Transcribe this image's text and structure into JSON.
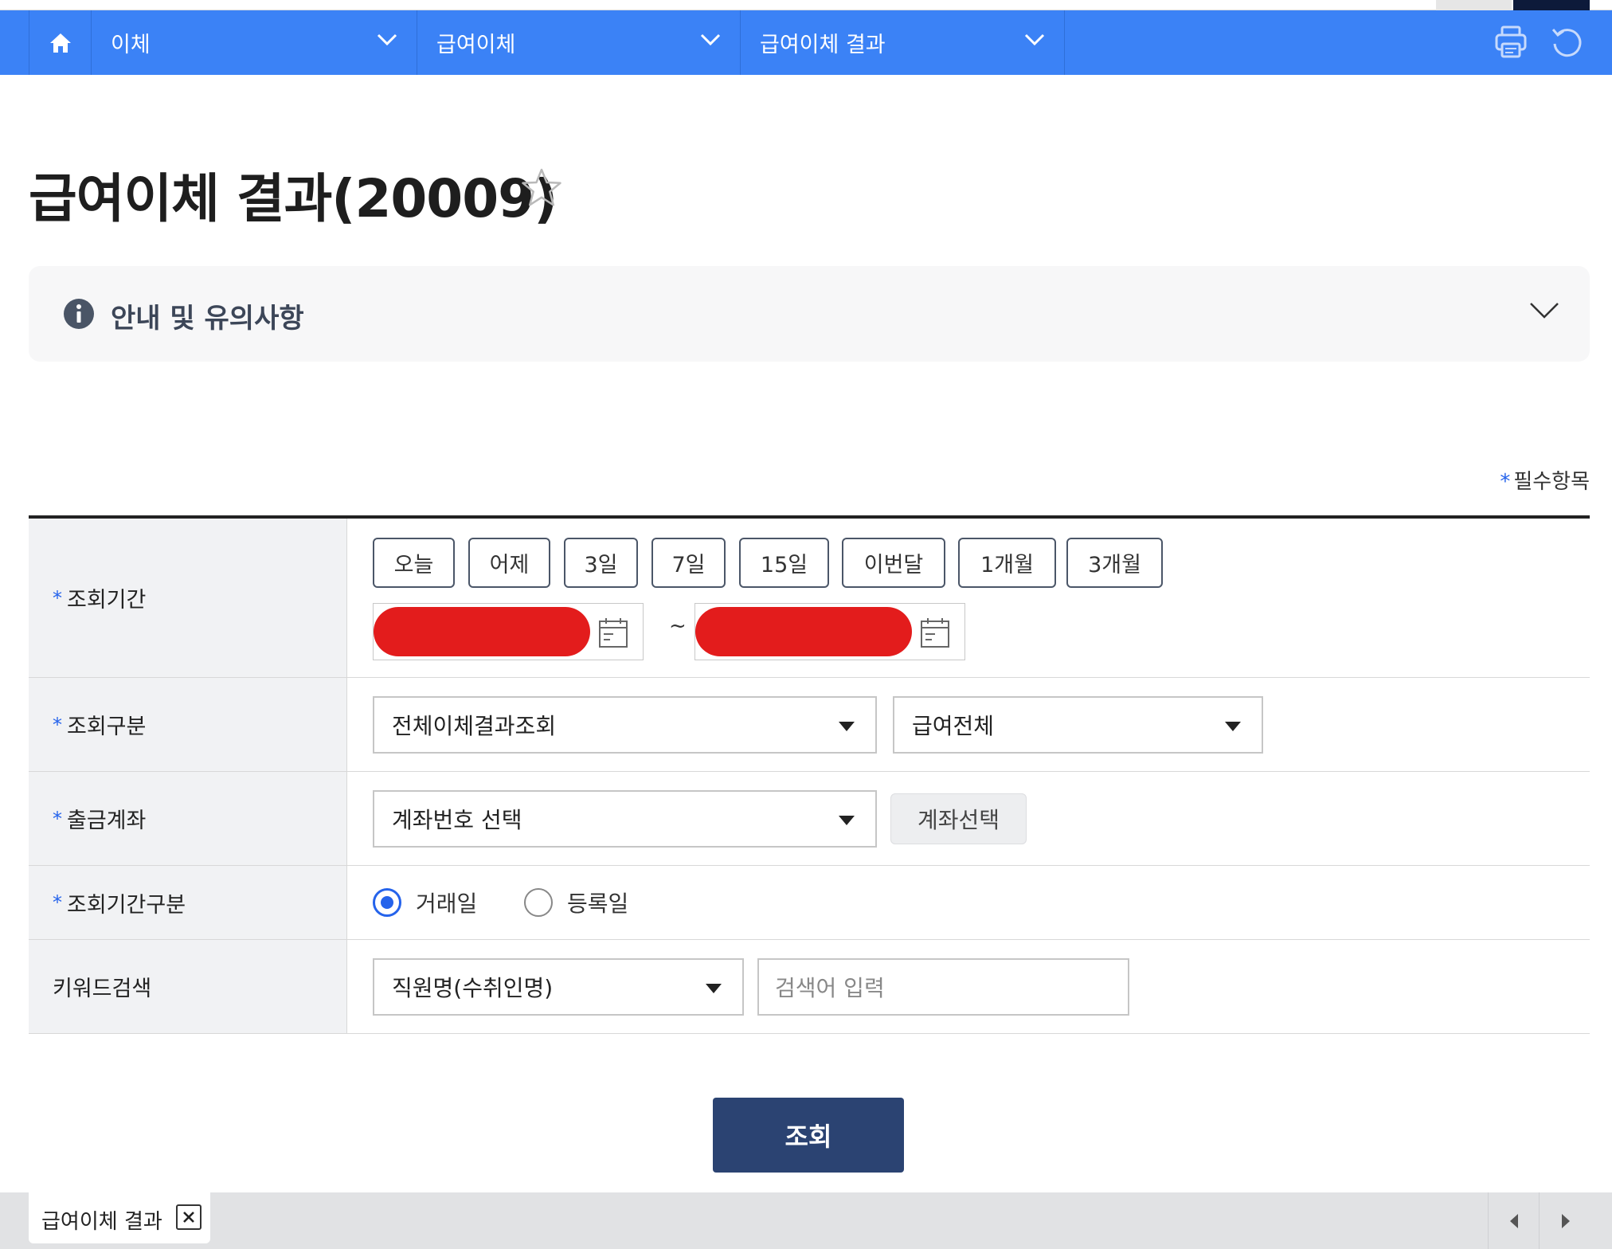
{
  "nav": {
    "home_icon": "home-icon",
    "segments": [
      {
        "label": "이체"
      },
      {
        "label": "급여이체"
      },
      {
        "label": "급여이체 결과"
      }
    ],
    "tools": [
      "print-icon",
      "refresh-icon"
    ]
  },
  "page": {
    "title": "급여이체 결과(20009)",
    "favorite_icon": "star-outline-icon"
  },
  "notice": {
    "label": "안내 및 유의사항",
    "icon": "info-icon"
  },
  "required_note": "필수항목",
  "form": {
    "period": {
      "label": "조회기간",
      "quick_buttons": [
        "오늘",
        "어제",
        "3일",
        "7일",
        "15일",
        "이번달",
        "1개월",
        "3개월"
      ],
      "start_date": "",
      "end_date": "",
      "separator": "~"
    },
    "inquiry_type": {
      "label": "조회구분",
      "select1": "전체이체결과조회",
      "select2": "급여전체"
    },
    "account": {
      "label": "출금계좌",
      "select": "계좌번호 선택",
      "button": "계좌선택"
    },
    "period_type": {
      "label": "조회기간구분",
      "options": [
        "거래일",
        "등록일"
      ],
      "selected": "거래일"
    },
    "keyword": {
      "label": "키워드검색",
      "select": "직원명(수취인명)",
      "placeholder": "검색어 입력"
    }
  },
  "search_button": "조회",
  "bottom_tabs": [
    {
      "label": "급여이체 결과"
    }
  ],
  "colors": {
    "nav_blue": "#3b82f6",
    "primary_navy": "#2b4372",
    "required_star": "#2563eb",
    "redaction": "#e31c1c"
  }
}
